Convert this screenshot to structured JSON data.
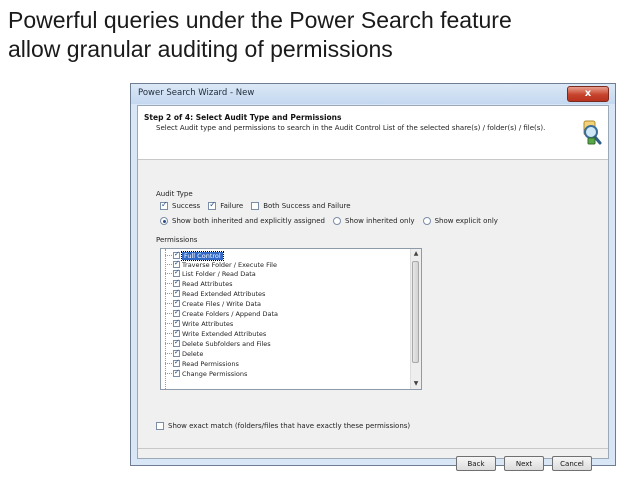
{
  "slide": {
    "title_line1": "Powerful queries under the Power Search feature",
    "title_line2": "allow granular auditing of permissions"
  },
  "window": {
    "title": "Power Search Wizard - New",
    "close_label": "x"
  },
  "header": {
    "step_title": "Step 2 of 4: Select Audit Type and Permissions",
    "step_description": "Select Audit type and permissions to search in the Audit Control List of the selected share(s) / folder(s) / file(s).",
    "icon": "magnifier-lock-icon"
  },
  "audit_type": {
    "label": "Audit Type",
    "checkboxes": [
      {
        "label": "Success",
        "checked": true
      },
      {
        "label": "Failure",
        "checked": true
      },
      {
        "label": "Both Success and Failure",
        "checked": false
      }
    ],
    "radios": [
      {
        "label": "Show both inherited and explicitly assigned",
        "selected": true
      },
      {
        "label": "Show inherited only",
        "selected": false
      },
      {
        "label": "Show explicit only",
        "selected": false
      }
    ]
  },
  "permissions": {
    "label": "Permissions",
    "items": [
      {
        "label": "Full Control",
        "checked": true,
        "selected": true
      },
      {
        "label": "Traverse Folder / Execute File",
        "checked": true
      },
      {
        "label": "List Folder / Read Data",
        "checked": true
      },
      {
        "label": "Read Attributes",
        "checked": true
      },
      {
        "label": "Read Extended Attributes",
        "checked": true
      },
      {
        "label": "Create Files / Write Data",
        "checked": true
      },
      {
        "label": "Create Folders / Append Data",
        "checked": true
      },
      {
        "label": "Write Attributes",
        "checked": true
      },
      {
        "label": "Write Extended Attributes",
        "checked": true
      },
      {
        "label": "Delete Subfolders and Files",
        "checked": true
      },
      {
        "label": "Delete",
        "checked": true
      },
      {
        "label": "Read Permissions",
        "checked": true
      },
      {
        "label": "Change Permissions",
        "checked": true
      }
    ]
  },
  "exact_match": {
    "label": "Show exact match (folders/files that have exactly these permissions)",
    "checked": false
  },
  "footer": {
    "back_label": "Back",
    "next_label": "Next",
    "cancel_label": "Cancel"
  }
}
